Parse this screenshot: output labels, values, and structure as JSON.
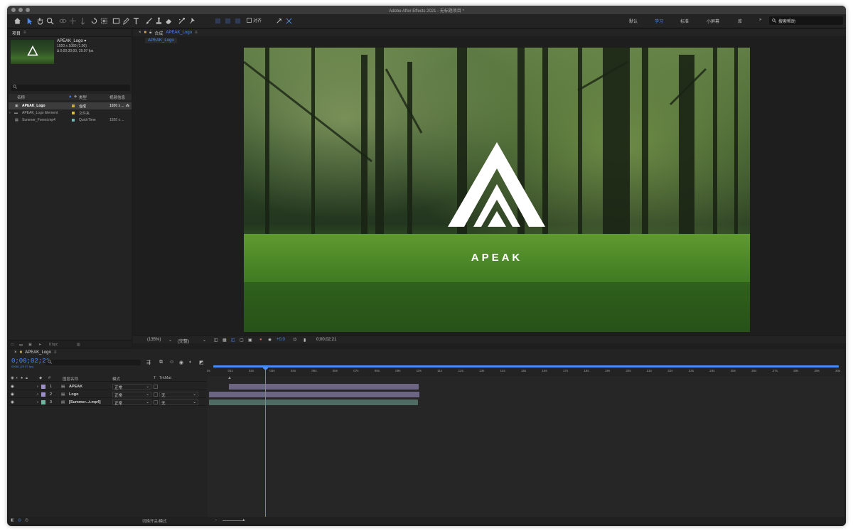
{
  "window_title": "Adobe After Effects 2021 - 无标题项目 *",
  "toolbar": {
    "snap_label": "对齐",
    "workspaces": [
      {
        "label": "默认",
        "active": false
      },
      {
        "label": "学习",
        "active": true
      },
      {
        "label": "标准",
        "active": false
      },
      {
        "label": "小屏幕",
        "active": false
      },
      {
        "label": "库",
        "active": false
      }
    ],
    "more_label": "»",
    "help_search_placeholder": "搜索帮助"
  },
  "project": {
    "panel_title": "项目",
    "selected_name": "APEAK_Logo ▾",
    "selected_size": "1920 x 1080 (1.00)",
    "selected_duration": "Δ 0;00;30;00, 29.97 fps",
    "columns": {
      "name": "名称",
      "type": "类型",
      "info": "视频信息"
    },
    "items": [
      {
        "name": "APEAK_Logo",
        "type": "合成",
        "info": "1920 x ...",
        "color": "#c8a84a",
        "selected": true
      },
      {
        "name": "APEAK_Logo Element",
        "type": "文件夹",
        "info": "",
        "color": "#d9b94a",
        "selected": false
      },
      {
        "name": "Summer_Forest.mp4",
        "type": "QuickTime",
        "info": "1920 x ...",
        "color": "#6fb7b0",
        "selected": false
      }
    ],
    "bpc_label": "8 bpc"
  },
  "composition": {
    "tab_prefix": "合成",
    "tab_name": "APEAK_Logo",
    "subtab": "APEAK_Logo",
    "logo_text": "APEAK",
    "zoom": "(135%)",
    "quality": "(完整)",
    "exposure": "+0.0",
    "timecode": "0;00;02;21"
  },
  "timeline": {
    "tab_name": "APEAK_Logo",
    "timecode": "0;00;02;21",
    "fps_label": "00081 (29.97 fps)",
    "columns": {
      "number": "#",
      "layer_name": "图层名称",
      "mode": "模式",
      "t": "T",
      "trkmat": "TrkMat"
    },
    "layers": [
      {
        "index": "1",
        "name": "APEAK",
        "mode": "正常",
        "trkmat": "",
        "color": "#9d8fc9",
        "bar_color": "#6c6584"
      },
      {
        "index": "2",
        "name": "Logo",
        "mode": "正常",
        "trkmat": "无",
        "color": "#9d8fc9",
        "bar_color": "#6c6584"
      },
      {
        "index": "3",
        "name": "[Summer...t.mp4]",
        "mode": "正常",
        "trkmat": "无",
        "color": "#6fb7a0",
        "bar_color": "#4f6b63"
      }
    ],
    "ruler_ticks": [
      "0s",
      "01s",
      "02s",
      "03s",
      "04s",
      "05s",
      "06s",
      "07s",
      "08s",
      "09s",
      "10s",
      "11s",
      "12s",
      "13s",
      "14s",
      "15s",
      "16s",
      "17s",
      "18s",
      "19s",
      "20s",
      "21s",
      "22s",
      "23s",
      "24s",
      "25s",
      "26s",
      "27s",
      "28s",
      "29s",
      "30s"
    ],
    "footer_label": "切换开关/模式"
  }
}
